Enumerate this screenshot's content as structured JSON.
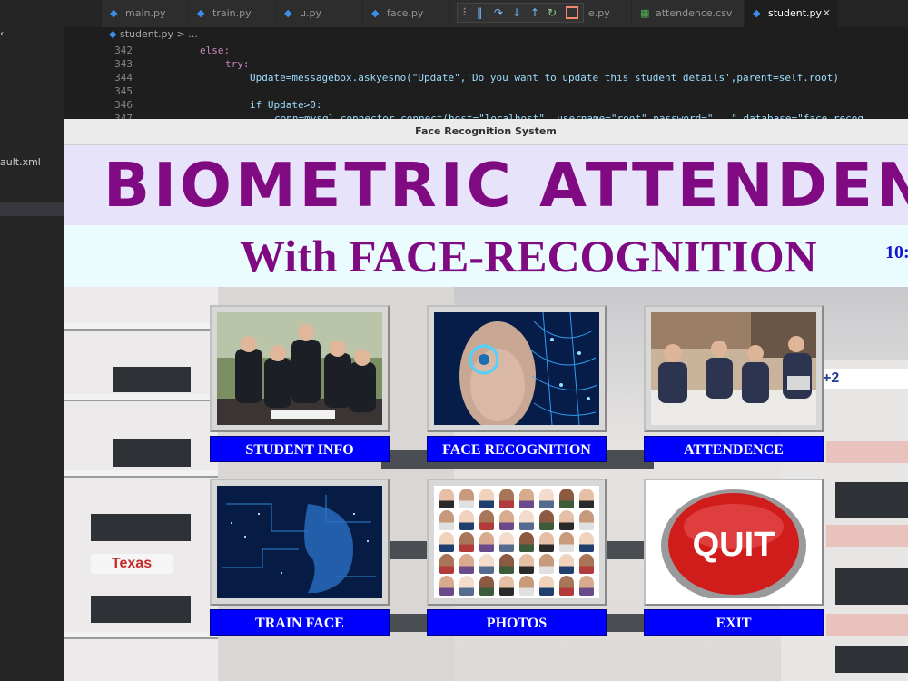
{
  "editor": {
    "sidebar_items": [
      "ault.xml"
    ],
    "tabs": [
      {
        "label": "main.py",
        "icon": "python-file-icon"
      },
      {
        "label": "train.py",
        "icon": "python-file-icon"
      },
      {
        "label": "u.py",
        "icon": "python-file-icon"
      },
      {
        "label": "face.py",
        "icon": "python-file-icon"
      },
      {
        "label": "e.py",
        "icon": "python-file-icon"
      },
      {
        "label": "attendence.csv",
        "icon": "csv-file-icon"
      },
      {
        "label": "student.py",
        "icon": "python-file-icon",
        "active": true
      }
    ],
    "more_dots": "···",
    "breadcrumb": "student.py > ...",
    "code_lines": [
      {
        "num": "342",
        "text": "else:"
      },
      {
        "num": "343",
        "text": "try:"
      },
      {
        "num": "344",
        "text": "Update=messagebox.askyesno(\"Update\",'Do you want to update this student details',parent=self.root)"
      },
      {
        "num": "345",
        "text": ""
      },
      {
        "num": "346",
        "text": "if Update>0:"
      },
      {
        "num": "347",
        "text": "conn=mysql.connector.connect(host=\"localhost\", username=\"root\",password=\"...\",database=\"face_recog"
      }
    ],
    "debug_icons": [
      "drag-handle-icon",
      "pause-icon",
      "step-over-icon",
      "step-into-icon",
      "step-out-icon",
      "restart-icon",
      "stop-icon"
    ]
  },
  "app": {
    "window_title": "Face Recognition System",
    "hero_title": "BIOMETRIC ATTENDENCE",
    "sub_title": "With FACE-RECOGNITION",
    "clock": "10:",
    "buttons": {
      "student_info": "STUDENT INFO",
      "face_recognition": "FACE RECOGNITION",
      "attendence": "ATTENDENCE",
      "train_face": "TRAIN FACE",
      "photos": "PHOTOS",
      "exit": "EXIT"
    },
    "quit_sign": "QUIT",
    "building_sign": {
      "brand": "Texas",
      "plus": "+2"
    }
  },
  "colors": {
    "title_purple": "#7f0a82",
    "button_blue": "#0000ff",
    "clock_blue": "#1414d8",
    "hero_bg": "#e7e3fb",
    "sub_bg": "#eafcfd",
    "quit_red": "#d11c1c"
  }
}
